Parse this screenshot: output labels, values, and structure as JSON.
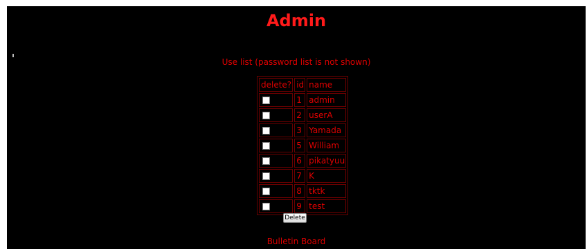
{
  "page": {
    "title": "Admin",
    "subtitle": "Use list (password list is not shown)",
    "colors": {
      "background": "#000000",
      "text": "#e00000",
      "title": "#ff1a1a",
      "border": "#6a0000"
    }
  },
  "table": {
    "headers": {
      "delete": "delete?",
      "id": "id",
      "name": "name"
    },
    "rows": [
      {
        "id": "1",
        "name": "admin",
        "checked": false
      },
      {
        "id": "2",
        "name": "userA",
        "checked": false
      },
      {
        "id": "3",
        "name": "Yamada",
        "checked": false
      },
      {
        "id": "5",
        "name": "William",
        "checked": false
      },
      {
        "id": "6",
        "name": "pikatyuu",
        "checked": false
      },
      {
        "id": "7",
        "name": "K",
        "checked": false
      },
      {
        "id": "8",
        "name": "tktk",
        "checked": false
      },
      {
        "id": "9",
        "name": "test",
        "checked": false
      }
    ]
  },
  "actions": {
    "delete_label": "Delete"
  },
  "footer": {
    "link_label": "Bulletin Board"
  }
}
